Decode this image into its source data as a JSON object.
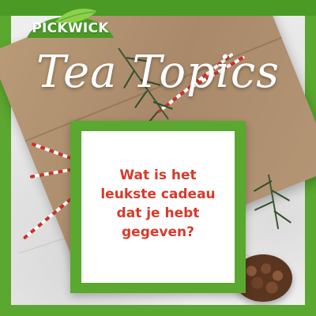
{
  "brand": {
    "logo_text": "PICKWICK",
    "primary_green": "#5aa82f",
    "dark_green": "#4b9a26"
  },
  "headline": "Tea Topics",
  "question": {
    "lines": [
      "Wat is het",
      "leukste cadeau",
      "dat je hebt",
      "gegeven?"
    ],
    "color": "#d63a2b"
  },
  "scene": {
    "parcel_color": "#b49675",
    "twine_colors": [
      "#c8322c",
      "#ffffff"
    ],
    "decor_icons": [
      "fir-branch-icon",
      "pine-cone-icon",
      "leaf-icon"
    ]
  }
}
